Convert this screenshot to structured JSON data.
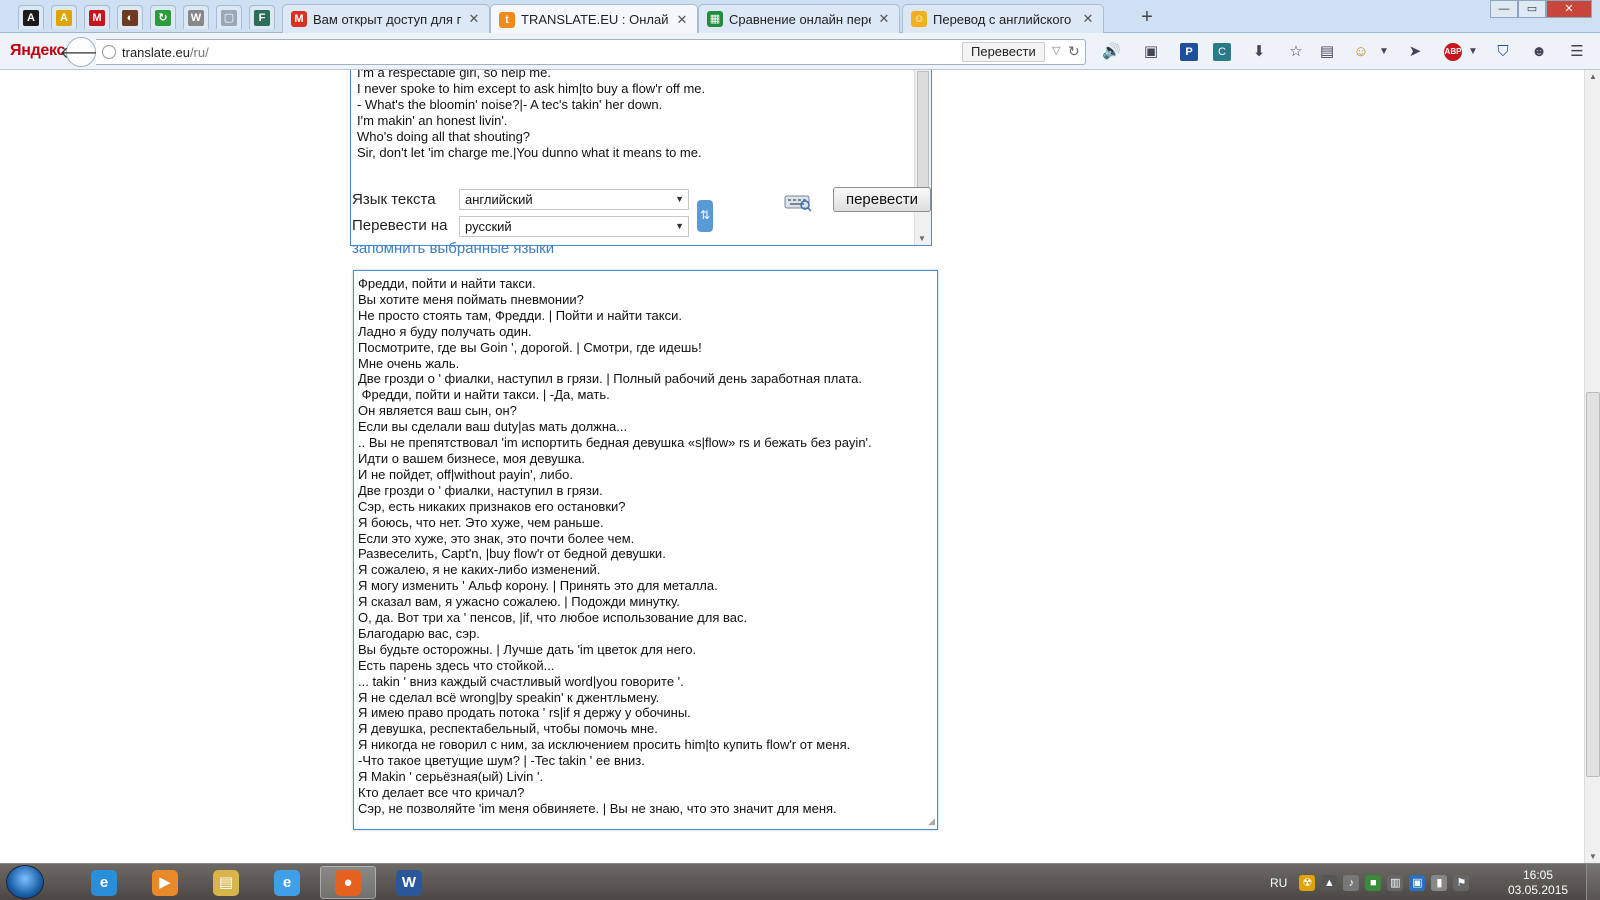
{
  "browser": {
    "pinned_tabs": [
      {
        "icon": "A",
        "color": "#1b1b1b",
        "name": "pinned-tab-a-black"
      },
      {
        "icon": "A",
        "color": "#e0a400",
        "name": "pinned-tab-a-yellow"
      },
      {
        "icon": "M",
        "color": "#c3161c",
        "name": "pinned-tab-m"
      },
      {
        "icon": "◐",
        "color": "#6b3a1f",
        "name": "pinned-tab-3"
      },
      {
        "icon": "↻",
        "color": "#2a9d3a",
        "name": "pinned-tab-4"
      },
      {
        "icon": "W",
        "color": "#888888",
        "name": "pinned-tab-wiki"
      },
      {
        "icon": "▢",
        "color": "#9aa8b8",
        "name": "pinned-tab-6"
      },
      {
        "icon": "F",
        "color": "#2d6e58",
        "name": "pinned-tab-f"
      }
    ],
    "tabs": [
      {
        "title": "Вам открыт доступ для пр...",
        "icon": "M",
        "color": "#d93025",
        "active": false
      },
      {
        "title": "TRANSLATE.EU : Онлайн п...",
        "icon": "t",
        "color": "#f28a1b",
        "active": true
      },
      {
        "title": "Сравнение онлайн перев...",
        "icon": "▦",
        "color": "#1e8e3e",
        "active": false
      },
      {
        "title": "Перевод с английского н...",
        "icon": "☺",
        "color": "#f2b01e",
        "active": false
      }
    ],
    "new_tab_symbol": "+",
    "window_buttons": {
      "minimize": "—",
      "maximize": "▭",
      "close": "✕"
    },
    "yandex_label": "Яндекс",
    "url_host": "translate.eu",
    "url_path": "/ru/",
    "url_translate_label": "Перевести"
  },
  "translator": {
    "source_lines": "I'm a respectable girl, so help me.\nI never spoke to him except to ask him|to buy a flow'r off me.\n- What's the bloomin' noise?|- A tec's takin' her down.\nI'm makin' an honest livin'.\nWho's doing all that shouting?\nSir, don't let 'im charge me.|You dunno what it means to me.",
    "source_lang_label": "Язык текста",
    "source_lang_value": "английский",
    "target_lang_label": "Перевести на",
    "target_lang_value": "русский",
    "translate_button": "перевести",
    "remember_link": "запомнить выбранные языки",
    "result_lines": "Фредди, пойти и найти такси.\nВы хотите меня поймать пневмонии?\nНе просто стоять там, Фредди. | Пойти и найти такси.\nЛадно я буду получать один.\nПосмотрите, где вы Goin ', дорогой. | Смотри, где идешь!\nМне очень жаль.\nДве грозди о ' фиалки, наступил в грязи. | Полный рабочий день заработная плата.\n Фредди, пойти и найти такси. | -Да, мать.\nОн является ваш сын, он?\nЕсли вы сделали ваш duty|as мать должна...\n.. Вы не препятствовал 'im испортить бедная девушка «s|flow» rs и бежать без payin'.\nИдти о вашем бизнесе, моя девушка.\nИ не пойдет, off|without payin', либо.\nДве грозди о ' фиалки, наступил в грязи.\nСэр, есть никаких признаков его остановки?\nЯ боюсь, что нет. Это хуже, чем раньше.\nЕсли это хуже, это знак, это почти более чем.\nРазвеселить, Capt'n, |buy flow'r от бедной девушки.\nЯ сожалею, я не каких-либо изменений.\nЯ могу изменить ' Альф корону. | Принять это для металла.\nЯ сказал вам, я ужасно сожалею. | Подожди минутку.\nО, да. Вот три ха ' пенсов, |if, что любое использование для вас.\nБлагодарю вас, сэр.\nВы будьте осторожны. | Лучше дать 'im цветок для него.\nЕсть парень здесь что стойкой...\n... takin ' вниз каждый счастливый word|you говорите '.\nЯ не сделал всё wrong|by speakin' к джентльмену.\nЯ имею право продать потока ' rs|if я держу у обочины.\nЯ девушка, респектабельный, чтобы помочь мне.\nЯ никогда не говорил с ним, за исключением просить him|to купить flow'r от меня.\n-Что такое цветущие шум? | -Tec takin ' ее вниз.\nЯ Makin ' серьёзная(ый) Livin '.\nКто делает все что кричал?\nСэр, не позволяйте 'im меня обвиняете. | Вы не знаю, что это значит для меня."
  },
  "taskbar": {
    "apps": [
      {
        "name": "taskbar-ie",
        "icon": "e",
        "color": "#2a8fd8",
        "active": false
      },
      {
        "name": "taskbar-media-player",
        "icon": "▶",
        "color": "#e8892a",
        "active": false
      },
      {
        "name": "taskbar-explorer",
        "icon": "▤",
        "color": "#d9b44a",
        "active": false
      },
      {
        "name": "taskbar-ie-2",
        "icon": "e",
        "color": "#3fa0e8",
        "active": false
      },
      {
        "name": "taskbar-firefox",
        "icon": "●",
        "color": "#e4611f",
        "active": true
      },
      {
        "name": "taskbar-word",
        "icon": "W",
        "color": "#2b579a",
        "active": false
      }
    ],
    "lang": "RU",
    "time": "16:05",
    "date": "03.05.2015"
  }
}
